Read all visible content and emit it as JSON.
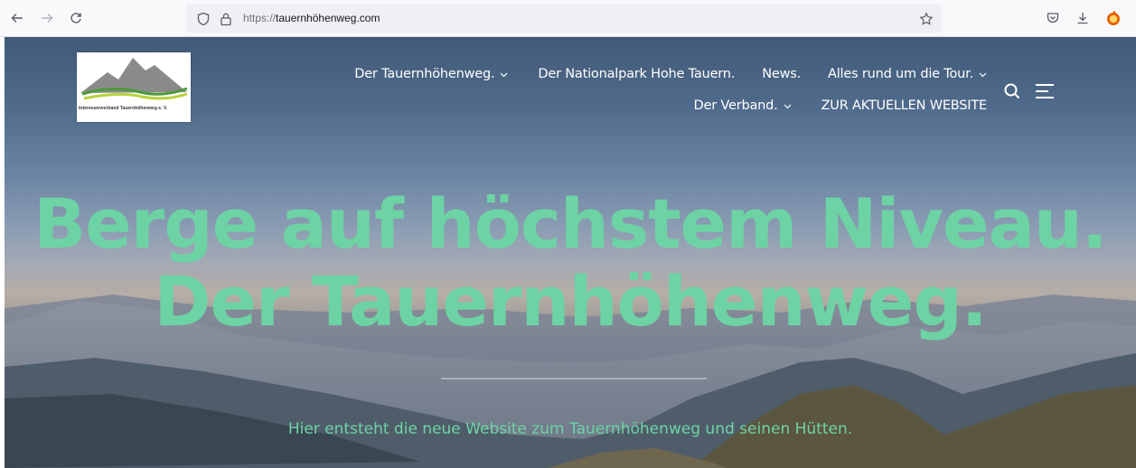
{
  "browser": {
    "url_protocol": "https://",
    "url_host": "tauernhöhenweg.com",
    "icons": [
      "back-icon",
      "forward-icon",
      "reload-icon",
      "shield-icon",
      "lock-icon",
      "star-icon",
      "pocket-icon",
      "download-icon",
      "account-icon"
    ]
  },
  "site": {
    "logo_caption": "Interessenverband Tauernhöhenweg e. V.",
    "nav_row1": [
      {
        "label": "Der Tauernhöhenweg.",
        "dropdown": true
      },
      {
        "label": "Der Nationalpark Hohe Tauern.",
        "dropdown": false
      },
      {
        "label": "News.",
        "dropdown": false
      },
      {
        "label": "Alles rund um die Tour.",
        "dropdown": true
      }
    ],
    "nav_row2": [
      {
        "label": "Der Verband.",
        "dropdown": true
      },
      {
        "label": "ZUR AKTUELLEN WEBSITE",
        "dropdown": false
      }
    ],
    "headline_line1": "Berge auf höchstem Niveau.",
    "headline_line2": "Der Tauernhöhenweg.",
    "subline": "Hier entsteht die neue Website zum Tauernhöhenweg und seinen Hütten.",
    "colors": {
      "accent": "#6dd3a4",
      "nav_text": "#ffffff"
    }
  }
}
